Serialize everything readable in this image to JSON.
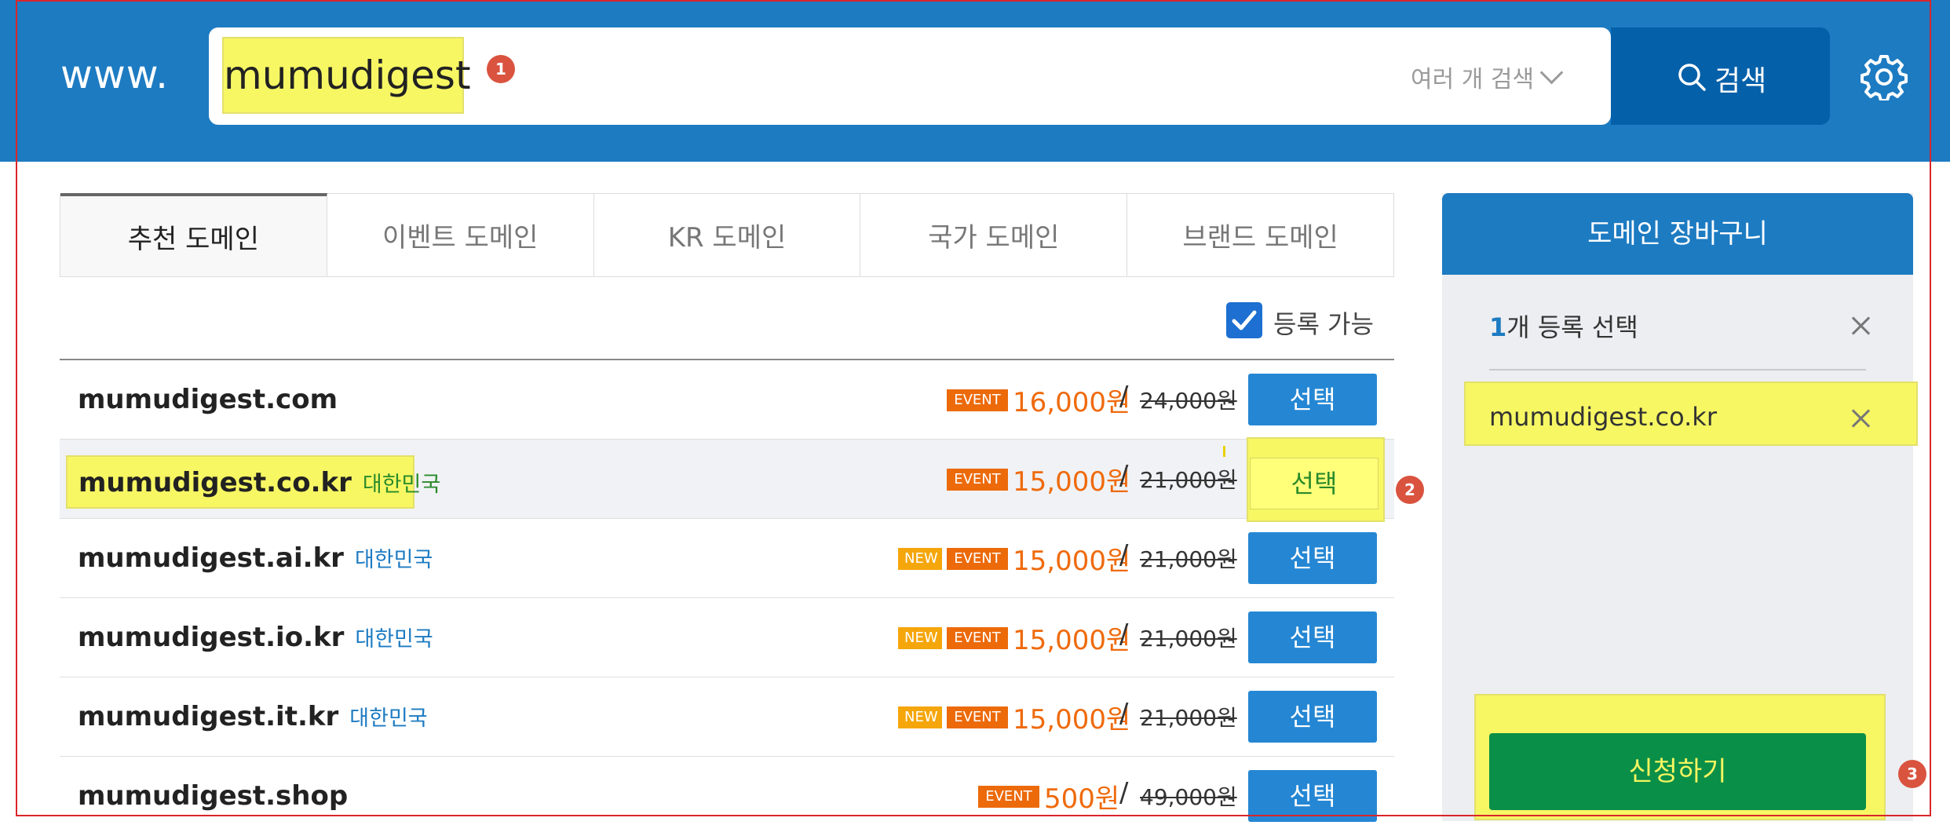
{
  "header": {
    "prefix": "www.",
    "query": "mumudigest",
    "multi_search_label": "여러 개 검색",
    "search_button": "검색"
  },
  "callouts": [
    "1",
    "2",
    "3"
  ],
  "tabs": [
    {
      "label": "추천 도메인",
      "active": true
    },
    {
      "label": "이벤트 도메인",
      "active": false
    },
    {
      "label": "KR 도메인",
      "active": false
    },
    {
      "label": "국가 도메인",
      "active": false
    },
    {
      "label": "브랜드 도메인",
      "active": false
    }
  ],
  "filter": {
    "available_label": "등록 가능",
    "checked": true
  },
  "rows": [
    {
      "domain": "mumudigest.com",
      "country": "",
      "tags": [
        "EVENT"
      ],
      "price": "16,000원",
      "orig": "24,000원",
      "button": "선택"
    },
    {
      "domain": "mumudigest.co.kr",
      "country": "대한민국",
      "tags": [
        "EVENT"
      ],
      "price": "15,000원",
      "orig": "21,000원",
      "button": "선택"
    },
    {
      "domain": "mumudigest.ai.kr",
      "country": "대한민국",
      "tags": [
        "NEW",
        "EVENT"
      ],
      "price": "15,000원",
      "orig": "21,000원",
      "button": "선택"
    },
    {
      "domain": "mumudigest.io.kr",
      "country": "대한민국",
      "tags": [
        "NEW",
        "EVENT"
      ],
      "price": "15,000원",
      "orig": "21,000원",
      "button": "선택"
    },
    {
      "domain": "mumudigest.it.kr",
      "country": "대한민국",
      "tags": [
        "NEW",
        "EVENT"
      ],
      "price": "15,000원",
      "orig": "21,000원",
      "button": "선택"
    },
    {
      "domain": "mumudigest.shop",
      "country": "",
      "tags": [
        "EVENT"
      ],
      "price": "500원",
      "orig": "49,000원",
      "button": "선택"
    }
  ],
  "cart": {
    "title": "도메인 장바구니",
    "count": "1",
    "count_suffix": "개 등록 선택",
    "items": [
      "mumudigest.co.kr"
    ],
    "apply_button": "신청하기"
  },
  "colors": {
    "header": "#1d7bc2",
    "event": "#ec6a0a",
    "new": "#f5a60b",
    "select": "#2587d4",
    "apply": "#0a8f48",
    "highlight": "#f7f764"
  }
}
